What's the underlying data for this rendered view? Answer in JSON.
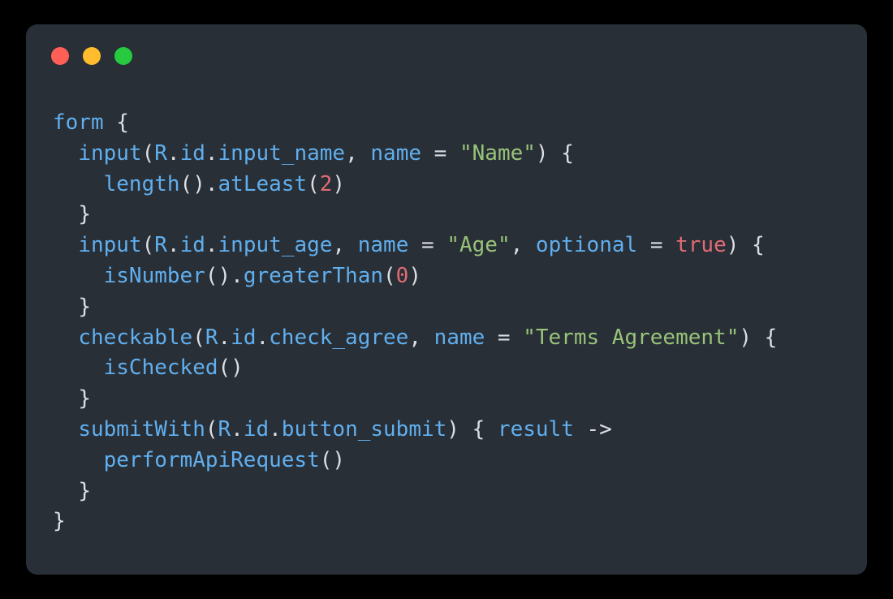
{
  "window": {
    "controls": [
      {
        "name": "close",
        "color": "#ff5f56"
      },
      {
        "name": "minimize",
        "color": "#ffbd2e"
      },
      {
        "name": "zoom",
        "color": "#27c93f"
      }
    ],
    "background": "#000000",
    "card_background": "#282f36"
  },
  "theme": {
    "plain": "#e8eaed",
    "identifier": "#61afef",
    "string": "#98c379",
    "number": "#e06c75",
    "keyword": "#e06c75",
    "punctuation": "#dcdfe4"
  },
  "code": {
    "language": "kotlin",
    "plain_text": "form {\n  input(R.id.input_name, name = \"Name\") {\n    length().atLeast(2)\n  }\n  input(R.id.input_age, name = \"Age\", optional = true) {\n    isNumber().greaterThan(0)\n  }\n  checkable(R.id.check_agree, name = \"Terms Agreement\") {\n    isChecked()\n  }\n  submitWith(R.id.button_submit) { result ->\n    performApiRequest()\n  }\n}",
    "lines": [
      {
        "index": 1,
        "tokens": [
          {
            "t": "form",
            "c": "tok-ident"
          },
          {
            "t": " ",
            "c": "tok-plain"
          },
          {
            "t": "{",
            "c": "tok-punct"
          }
        ]
      },
      {
        "index": 2,
        "tokens": [
          {
            "t": "  ",
            "c": "tok-plain"
          },
          {
            "t": "input",
            "c": "tok-ident"
          },
          {
            "t": "(",
            "c": "tok-punct"
          },
          {
            "t": "R",
            "c": "tok-ident"
          },
          {
            "t": ".",
            "c": "tok-punct"
          },
          {
            "t": "id",
            "c": "tok-ident"
          },
          {
            "t": ".",
            "c": "tok-punct"
          },
          {
            "t": "input_name",
            "c": "tok-ident"
          },
          {
            "t": ",",
            "c": "tok-punct"
          },
          {
            "t": " ",
            "c": "tok-plain"
          },
          {
            "t": "name",
            "c": "tok-param"
          },
          {
            "t": " ",
            "c": "tok-plain"
          },
          {
            "t": "=",
            "c": "tok-operator"
          },
          {
            "t": " ",
            "c": "tok-plain"
          },
          {
            "t": "\"Name\"",
            "c": "tok-string"
          },
          {
            "t": ")",
            "c": "tok-punct"
          },
          {
            "t": " ",
            "c": "tok-plain"
          },
          {
            "t": "{",
            "c": "tok-punct"
          }
        ]
      },
      {
        "index": 3,
        "tokens": [
          {
            "t": "    ",
            "c": "tok-plain"
          },
          {
            "t": "length",
            "c": "tok-ident"
          },
          {
            "t": "()",
            "c": "tok-punct"
          },
          {
            "t": ".",
            "c": "tok-punct"
          },
          {
            "t": "atLeast",
            "c": "tok-ident"
          },
          {
            "t": "(",
            "c": "tok-punct"
          },
          {
            "t": "2",
            "c": "tok-number"
          },
          {
            "t": ")",
            "c": "tok-punct"
          }
        ]
      },
      {
        "index": 4,
        "tokens": [
          {
            "t": "  ",
            "c": "tok-plain"
          },
          {
            "t": "}",
            "c": "tok-punct"
          }
        ]
      },
      {
        "index": 5,
        "tokens": [
          {
            "t": "  ",
            "c": "tok-plain"
          },
          {
            "t": "input",
            "c": "tok-ident"
          },
          {
            "t": "(",
            "c": "tok-punct"
          },
          {
            "t": "R",
            "c": "tok-ident"
          },
          {
            "t": ".",
            "c": "tok-punct"
          },
          {
            "t": "id",
            "c": "tok-ident"
          },
          {
            "t": ".",
            "c": "tok-punct"
          },
          {
            "t": "input_age",
            "c": "tok-ident"
          },
          {
            "t": ",",
            "c": "tok-punct"
          },
          {
            "t": " ",
            "c": "tok-plain"
          },
          {
            "t": "name",
            "c": "tok-param"
          },
          {
            "t": " ",
            "c": "tok-plain"
          },
          {
            "t": "=",
            "c": "tok-operator"
          },
          {
            "t": " ",
            "c": "tok-plain"
          },
          {
            "t": "\"Age\"",
            "c": "tok-string"
          },
          {
            "t": ",",
            "c": "tok-punct"
          },
          {
            "t": " ",
            "c": "tok-plain"
          },
          {
            "t": "optional",
            "c": "tok-param"
          },
          {
            "t": " ",
            "c": "tok-plain"
          },
          {
            "t": "=",
            "c": "tok-operator"
          },
          {
            "t": " ",
            "c": "tok-plain"
          },
          {
            "t": "true",
            "c": "tok-keyword"
          },
          {
            "t": ")",
            "c": "tok-punct"
          },
          {
            "t": " ",
            "c": "tok-plain"
          },
          {
            "t": "{",
            "c": "tok-punct"
          }
        ]
      },
      {
        "index": 6,
        "tokens": [
          {
            "t": "    ",
            "c": "tok-plain"
          },
          {
            "t": "isNumber",
            "c": "tok-ident"
          },
          {
            "t": "()",
            "c": "tok-punct"
          },
          {
            "t": ".",
            "c": "tok-punct"
          },
          {
            "t": "greaterThan",
            "c": "tok-ident"
          },
          {
            "t": "(",
            "c": "tok-punct"
          },
          {
            "t": "0",
            "c": "tok-number"
          },
          {
            "t": ")",
            "c": "tok-punct"
          }
        ]
      },
      {
        "index": 7,
        "tokens": [
          {
            "t": "  ",
            "c": "tok-plain"
          },
          {
            "t": "}",
            "c": "tok-punct"
          }
        ]
      },
      {
        "index": 8,
        "tokens": [
          {
            "t": "  ",
            "c": "tok-plain"
          },
          {
            "t": "checkable",
            "c": "tok-ident"
          },
          {
            "t": "(",
            "c": "tok-punct"
          },
          {
            "t": "R",
            "c": "tok-ident"
          },
          {
            "t": ".",
            "c": "tok-punct"
          },
          {
            "t": "id",
            "c": "tok-ident"
          },
          {
            "t": ".",
            "c": "tok-punct"
          },
          {
            "t": "check_agree",
            "c": "tok-ident"
          },
          {
            "t": ",",
            "c": "tok-punct"
          },
          {
            "t": " ",
            "c": "tok-plain"
          },
          {
            "t": "name",
            "c": "tok-param"
          },
          {
            "t": " ",
            "c": "tok-plain"
          },
          {
            "t": "=",
            "c": "tok-operator"
          },
          {
            "t": " ",
            "c": "tok-plain"
          },
          {
            "t": "\"Terms Agreement\"",
            "c": "tok-string"
          },
          {
            "t": ")",
            "c": "tok-punct"
          },
          {
            "t": " ",
            "c": "tok-plain"
          },
          {
            "t": "{",
            "c": "tok-punct"
          }
        ]
      },
      {
        "index": 9,
        "tokens": [
          {
            "t": "    ",
            "c": "tok-plain"
          },
          {
            "t": "isChecked",
            "c": "tok-ident"
          },
          {
            "t": "()",
            "c": "tok-punct"
          }
        ]
      },
      {
        "index": 10,
        "tokens": [
          {
            "t": "  ",
            "c": "tok-plain"
          },
          {
            "t": "}",
            "c": "tok-punct"
          }
        ]
      },
      {
        "index": 11,
        "tokens": [
          {
            "t": "  ",
            "c": "tok-plain"
          },
          {
            "t": "submitWith",
            "c": "tok-ident"
          },
          {
            "t": "(",
            "c": "tok-punct"
          },
          {
            "t": "R",
            "c": "tok-ident"
          },
          {
            "t": ".",
            "c": "tok-punct"
          },
          {
            "t": "id",
            "c": "tok-ident"
          },
          {
            "t": ".",
            "c": "tok-punct"
          },
          {
            "t": "button_submit",
            "c": "tok-ident"
          },
          {
            "t": ")",
            "c": "tok-punct"
          },
          {
            "t": " ",
            "c": "tok-plain"
          },
          {
            "t": "{",
            "c": "tok-punct"
          },
          {
            "t": " ",
            "c": "tok-plain"
          },
          {
            "t": "result",
            "c": "tok-param"
          },
          {
            "t": " ",
            "c": "tok-plain"
          },
          {
            "t": "->",
            "c": "tok-operator"
          }
        ]
      },
      {
        "index": 12,
        "tokens": [
          {
            "t": "    ",
            "c": "tok-plain"
          },
          {
            "t": "performApiRequest",
            "c": "tok-ident"
          },
          {
            "t": "()",
            "c": "tok-punct"
          }
        ]
      },
      {
        "index": 13,
        "tokens": [
          {
            "t": "  ",
            "c": "tok-plain"
          },
          {
            "t": "}",
            "c": "tok-punct"
          }
        ]
      },
      {
        "index": 14,
        "tokens": [
          {
            "t": "}",
            "c": "tok-punct"
          }
        ]
      }
    ]
  }
}
